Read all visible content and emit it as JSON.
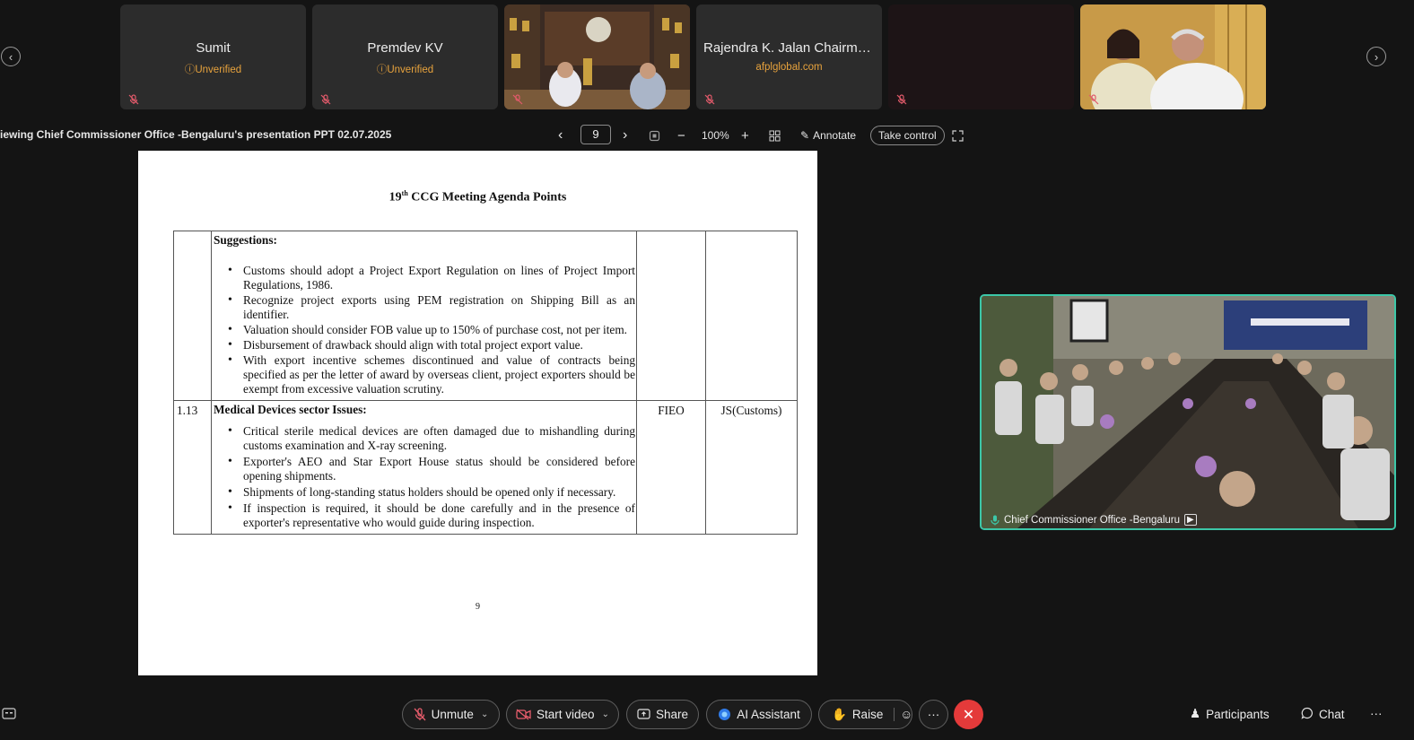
{
  "participants": [
    {
      "name": "Sumit",
      "status": "Unverified"
    },
    {
      "name": "Premdev KV",
      "status": "Unverified"
    },
    {
      "name": "Rajendra K. Jalan Chairman...",
      "status": "afplglobal.com"
    }
  ],
  "toolbar": {
    "share_title": "iewing Chief Commissioner Office -Bengaluru's presentation PPT 02.07.2025",
    "page": "9",
    "zoom": "100%",
    "annotate": "Annotate",
    "take_control": "Take control"
  },
  "document": {
    "title_pre": "19",
    "title_sup": "th",
    "title_post": " CCG Meeting Agenda Points",
    "rows": [
      {
        "no": "",
        "heading": "Suggestions:",
        "points": [
          "Customs should adopt a Project Export Regulation on lines of Project Import Regulations, 1986.",
          "Recognize project exports using PEM registration on Shipping Bill as an identifier.",
          "Valuation should consider FOB value up to 150% of purchase cost, not per item.",
          "Disbursement of drawback should align with total project export value.",
          "With export incentive schemes discontinued and value of contracts being specified as per the letter of award by overseas client, project exporters should be exempt from excessive valuation scrutiny."
        ],
        "raised_by": "",
        "action": ""
      },
      {
        "no": "1.13",
        "heading": "Medical Devices sector Issues:",
        "points": [
          "Critical sterile medical devices are often damaged due to mishandling during customs examination and X-ray screening.",
          "Exporter's AEO and Star Export House status should be considered before opening shipments.",
          "Shipments of long-standing status holders should be opened only if necessary.",
          "If inspection is required, it should be done carefully and in the presence of exporter's representative who would guide during inspection."
        ],
        "raised_by": "FIEO",
        "action": "JS(Customs)"
      }
    ],
    "page_number": "9"
  },
  "self_view": {
    "label": "Chief Commissioner Office -Bengaluru"
  },
  "bottom_bar": {
    "unmute": "Unmute",
    "start_video": "Start video",
    "share": "Share",
    "ai_assistant": "AI Assistant",
    "raise": "Raise",
    "more": "···",
    "participants": "Participants",
    "chat": "Chat",
    "overflow": "···"
  },
  "colors": {
    "accent": "#3cc7a8",
    "warning": "#e8a33d",
    "end_call": "#e43a3a"
  }
}
